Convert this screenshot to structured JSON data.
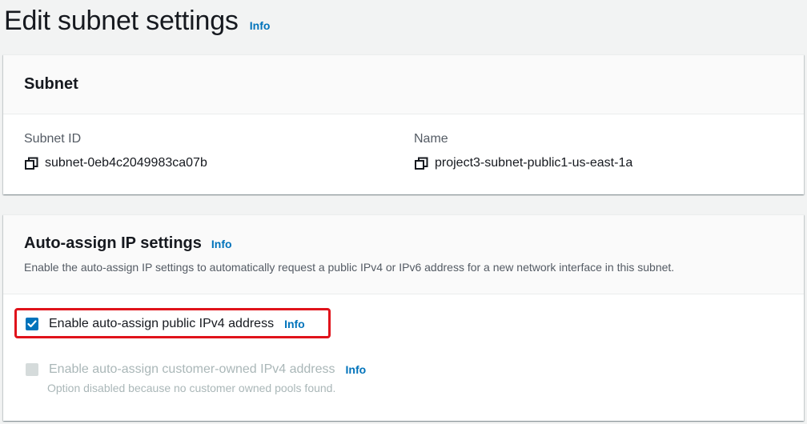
{
  "header": {
    "title": "Edit subnet settings",
    "info_label": "Info"
  },
  "subnet_panel": {
    "title": "Subnet",
    "subnet_id_label": "Subnet ID",
    "subnet_id_value": "subnet-0eb4c2049983ca07b",
    "name_label": "Name",
    "name_value": "project3-subnet-public1-us-east-1a",
    "copy_icon": "copy-icon"
  },
  "auto_assign_panel": {
    "title": "Auto-assign IP settings",
    "info_label": "Info",
    "description": "Enable the auto-assign IP settings to automatically request a public IPv4 or IPv6 address for a new network interface in this subnet.",
    "options": [
      {
        "label": "Enable auto-assign public IPv4 address",
        "info_label": "Info",
        "checked": true,
        "disabled": false
      },
      {
        "label": "Enable auto-assign customer-owned IPv4 address",
        "info_label": "Info",
        "checked": false,
        "disabled": true,
        "helper_text": "Option disabled because no customer owned pools found."
      }
    ]
  },
  "colors": {
    "link": "#0073bb",
    "checkbox_checked": "#0073bb",
    "highlight": "#e0131b",
    "disabled_text": "#aab7b8"
  }
}
